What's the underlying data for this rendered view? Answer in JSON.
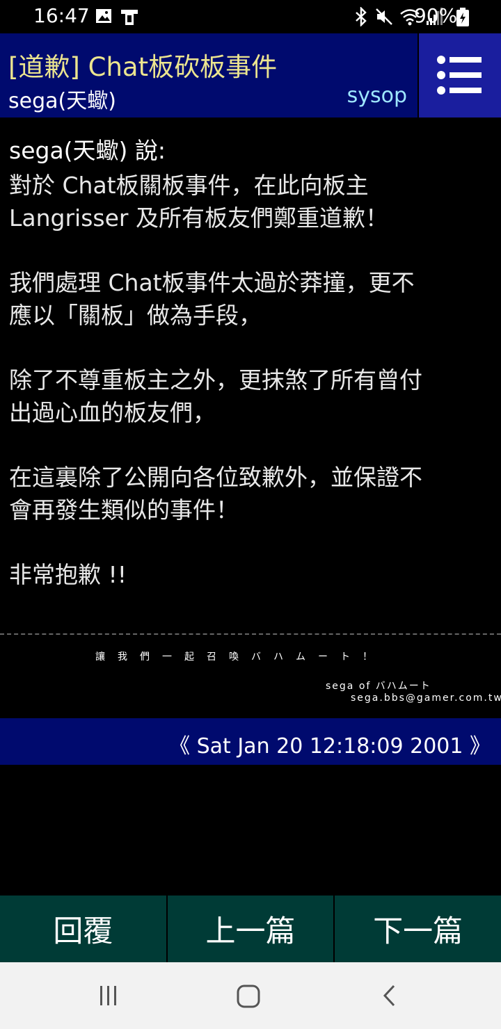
{
  "status": {
    "time": "16:47",
    "battery_pct": "90%"
  },
  "header": {
    "title": "[道歉] Chat板砍板事件",
    "author": "sega(天蠍)",
    "board": "sysop"
  },
  "article": {
    "said": "sega(天蠍) 說:",
    "paragraphs": [
      [
        "對於 Chat板關板事件，在此向板主",
        "Langrisser 及所有板友們鄭重道歉！"
      ],
      [
        "我們處理 Chat板事件太過於莽撞，更不",
        "應以「關板」做為手段，"
      ],
      [
        "除了不尊重板主之外，更抹煞了所有曾付",
        "出過心血的板友們，"
      ],
      [
        "在這裏除了公開向各位致歉外，並保證不",
        "會再發生類似的事件！"
      ],
      [
        "非常抱歉 !!"
      ]
    ]
  },
  "signature": {
    "line1": "讓我們一起召喚バハムート！",
    "line2": "sega of バハムート",
    "line3": "sega.bbs@gamer.com.tw"
  },
  "date": "《 Sat Jan 20 12:18:09 2001 》",
  "nav": {
    "reply": "回覆",
    "prev": "上一篇",
    "next": "下一篇"
  },
  "icons": {
    "menu": "list-menu-icon",
    "android_recents": "recents-icon",
    "android_home": "home-icon",
    "android_back": "back-icon"
  },
  "colors": {
    "header_bg": "#000a6e",
    "title": "#ece58f",
    "board": "#9ee6ff",
    "bottom_bar": "#003b36"
  }
}
